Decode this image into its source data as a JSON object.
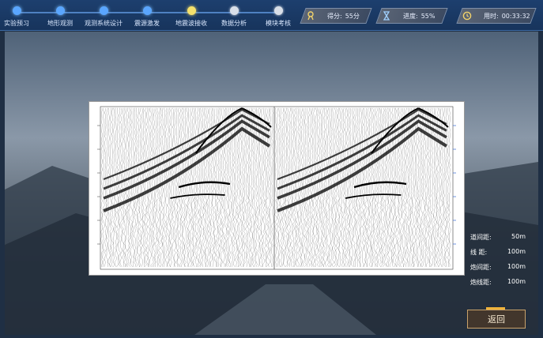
{
  "steps": [
    {
      "label": "实验预习",
      "state": "blue"
    },
    {
      "label": "地形观测",
      "state": "blue"
    },
    {
      "label": "观测系统设计",
      "state": "blue"
    },
    {
      "label": "震源激发",
      "state": "blue"
    },
    {
      "label": "地震波接收",
      "state": "yellow"
    },
    {
      "label": "数据分析",
      "state": "gray"
    },
    {
      "label": "模块考核",
      "state": "gray"
    }
  ],
  "stats": {
    "score": {
      "label": "得分:",
      "value": "55分",
      "icon": "medal-icon"
    },
    "progress": {
      "label": "进度:",
      "value": "55%",
      "icon": "hourglass-icon"
    },
    "time": {
      "label": "用时:",
      "value": "00:33:32",
      "icon": "clock-icon"
    }
  },
  "info": [
    {
      "label": "道间距:",
      "value": "50m"
    },
    {
      "label": "线 距:",
      "value": "100m"
    },
    {
      "label": "炮间距:",
      "value": "100m"
    },
    {
      "label": "炮线距:",
      "value": "100m"
    }
  ],
  "back_button": {
    "label": "返回"
  },
  "colors": {
    "accent": "#f5e16c",
    "step_done": "#5aa6ff",
    "step_pending": "#d9dfe8",
    "button_border": "#c9a26a"
  }
}
